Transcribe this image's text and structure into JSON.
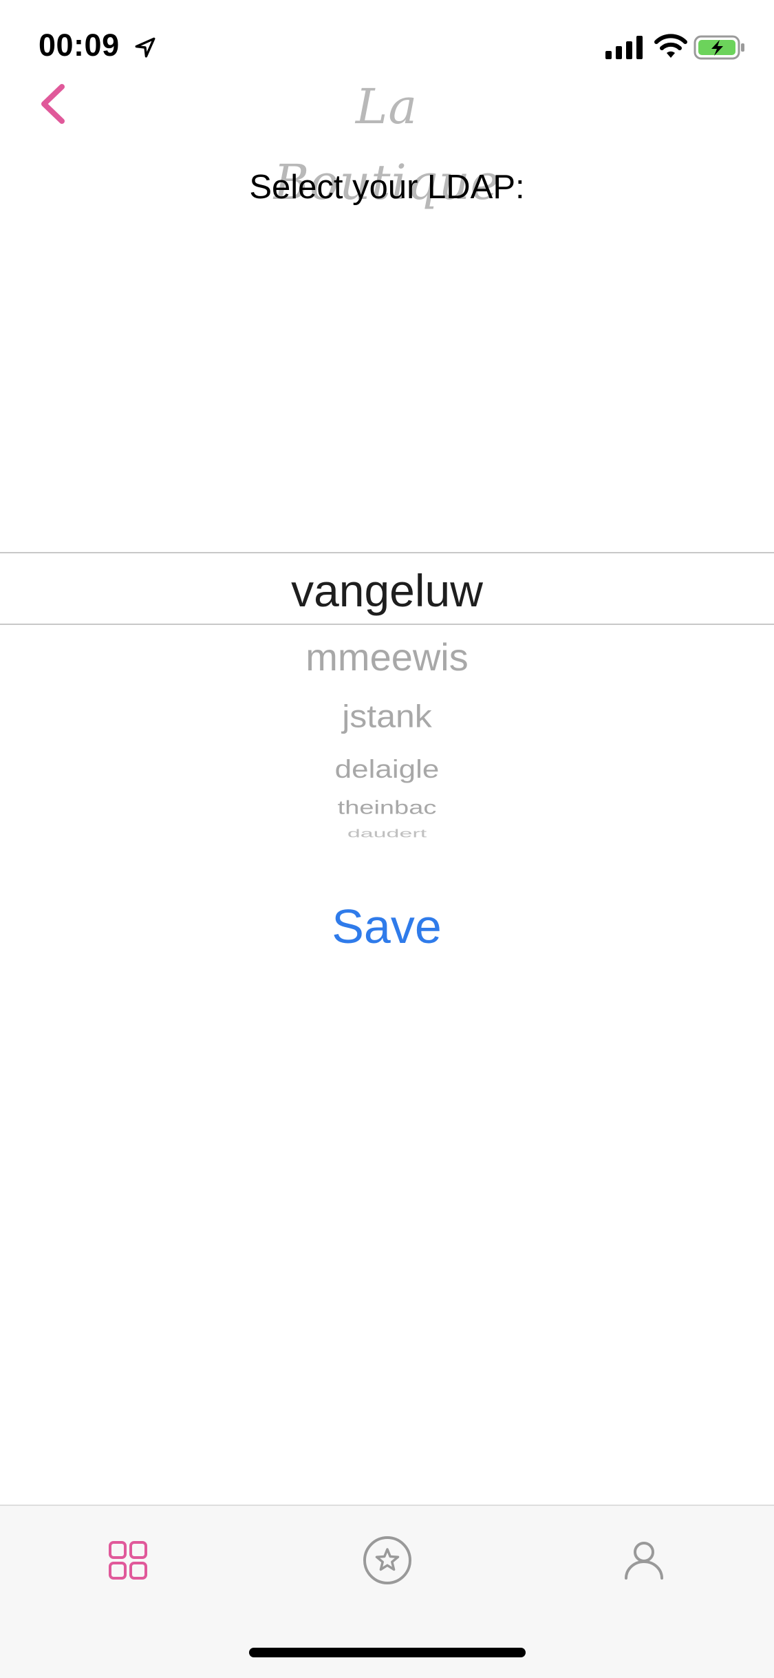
{
  "status_bar": {
    "time": "00:09",
    "location_icon": "location-arrow-icon",
    "signal_icon": "cellular-signal-icon",
    "wifi_icon": "wifi-icon",
    "battery_icon": "battery-charging-icon",
    "battery_color": "#6cd35b"
  },
  "nav": {
    "back_icon": "chevron-left-icon",
    "brand": "La Boutique",
    "accent_color": "#e0599a"
  },
  "prompt": "Select your LDAP:",
  "picker": {
    "selected": "vangeluw",
    "options_below": [
      "mmeewis",
      "jstank",
      "delaigle",
      "theinbac",
      "daudert"
    ]
  },
  "save_label": "Save",
  "tab_bar": {
    "tabs": [
      {
        "icon": "grid-icon",
        "active": true
      },
      {
        "icon": "star-circle-icon",
        "active": false
      },
      {
        "icon": "person-icon",
        "active": false
      }
    ],
    "active_color": "#e0599a",
    "inactive_color": "#999999"
  }
}
